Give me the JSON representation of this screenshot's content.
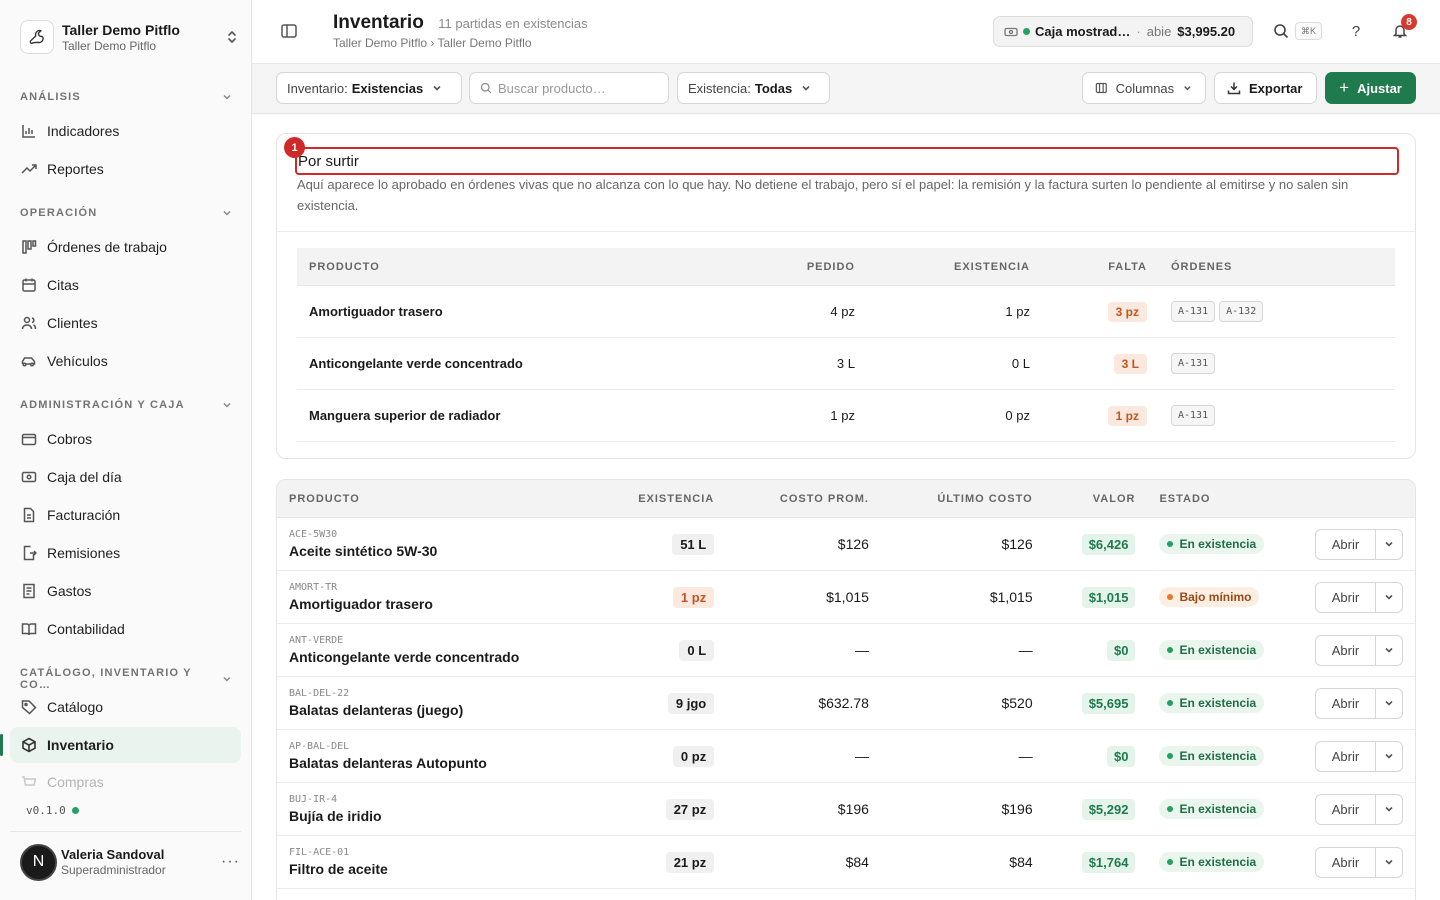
{
  "sidebar": {
    "org_name": "Taller Demo Pitflo",
    "org_sub": "Taller Demo Pitflo",
    "sections": [
      {
        "title": "ANÁLISIS",
        "items": [
          {
            "label": "Indicadores",
            "icon": "bar-chart-icon"
          },
          {
            "label": "Reportes",
            "icon": "trend-up-icon"
          }
        ]
      },
      {
        "title": "OPERACIÓN",
        "items": [
          {
            "label": "Órdenes de trabajo",
            "icon": "kanban-icon"
          },
          {
            "label": "Citas",
            "icon": "calendar-icon"
          },
          {
            "label": "Clientes",
            "icon": "users-icon"
          },
          {
            "label": "Vehículos",
            "icon": "car-icon"
          }
        ]
      },
      {
        "title": "ADMINISTRACIÓN Y CAJA",
        "items": [
          {
            "label": "Cobros",
            "icon": "wallet-icon"
          },
          {
            "label": "Caja del día",
            "icon": "cash-register-icon"
          },
          {
            "label": "Facturación",
            "icon": "invoice-icon"
          },
          {
            "label": "Remisiones",
            "icon": "file-export-icon"
          },
          {
            "label": "Gastos",
            "icon": "receipt-icon"
          },
          {
            "label": "Contabilidad",
            "icon": "book-icon"
          }
        ]
      },
      {
        "title": "CATÁLOGO, INVENTARIO Y CO…",
        "items": [
          {
            "label": "Catálogo",
            "icon": "tag-icon"
          },
          {
            "label": "Inventario",
            "icon": "box-icon"
          },
          {
            "label": "Compras",
            "icon": "cart-icon"
          }
        ]
      }
    ],
    "version": "v0.1.0",
    "user": {
      "initial": "N",
      "name": "Valeria Sandoval",
      "role": "Superadministrador",
      "more": "···"
    }
  },
  "header": {
    "title": "Inventario",
    "count": "11 partidas en existencias",
    "breadcrumb": "Taller Demo Pitflo › Taller Demo Pitflo",
    "cash": {
      "name": "Caja mostrad…",
      "sep": "·",
      "status": "abie",
      "amount": "$3,995.20"
    },
    "kbd": "⌘K",
    "help": "?",
    "notifications": "8"
  },
  "toolbar": {
    "inventory_label": "Inventario:",
    "inventory_value": "Existencias",
    "search_placeholder": "Buscar producto…",
    "stock_label": "Existencia:",
    "stock_value": "Todas",
    "columns": "Columnas",
    "export": "Exportar",
    "adjust": "Ajustar"
  },
  "por_surtir": {
    "marker": "1",
    "title": "Por surtir",
    "description": "Aquí aparece lo aprobado en órdenes vivas que no alcanza con lo que hay. No detiene el trabajo, pero sí el papel: la remisión y la factura surten lo pendiente al emitirse y no salen sin existencia.",
    "columns": [
      "PRODUCTO",
      "PEDIDO",
      "EXISTENCIA",
      "FALTA",
      "ÓRDENES"
    ],
    "rows": [
      {
        "product": "Amortiguador trasero",
        "ordered": "4 pz",
        "stock": "1 pz",
        "missing": "3 pz",
        "orders": [
          "A-131",
          "A-132"
        ]
      },
      {
        "product": "Anticongelante verde concentrado",
        "ordered": "3 L",
        "stock": "0 L",
        "missing": "3 L",
        "orders": [
          "A-131"
        ]
      },
      {
        "product": "Manguera superior de radiador",
        "ordered": "1 pz",
        "stock": "0 pz",
        "missing": "1 pz",
        "orders": [
          "A-131"
        ]
      }
    ]
  },
  "inventory": {
    "columns": [
      "PRODUCTO",
      "EXISTENCIA",
      "COSTO PROM.",
      "ÚLTIMO COSTO",
      "VALOR",
      "ESTADO"
    ],
    "open_label": "Abrir",
    "rows": [
      {
        "sku": "ACE-5W30",
        "name": "Aceite sintético 5W-30",
        "stock": "51 L",
        "low": false,
        "avg": "$126",
        "last": "$126",
        "value": "$6,426",
        "status": "En existencia",
        "warn": false
      },
      {
        "sku": "AMORT-TR",
        "name": "Amortiguador trasero",
        "stock": "1 pz",
        "low": true,
        "avg": "$1,015",
        "last": "$1,015",
        "value": "$1,015",
        "status": "Bajo mínimo",
        "warn": true
      },
      {
        "sku": "ANT-VERDE",
        "name": "Anticongelante verde concentrado",
        "stock": "0 L",
        "low": false,
        "avg": "—",
        "last": "—",
        "value": "$0",
        "status": "En existencia",
        "warn": false
      },
      {
        "sku": "BAL-DEL-22",
        "name": "Balatas delanteras (juego)",
        "stock": "9 jgo",
        "low": false,
        "avg": "$632.78",
        "last": "$520",
        "value": "$5,695",
        "status": "En existencia",
        "warn": false
      },
      {
        "sku": "AP-BAL-DEL",
        "name": "Balatas delanteras Autopunto",
        "stock": "0 pz",
        "low": false,
        "avg": "—",
        "last": "—",
        "value": "$0",
        "status": "En existencia",
        "warn": false
      },
      {
        "sku": "BUJ-IR-4",
        "name": "Bujía de iridio",
        "stock": "27 pz",
        "low": false,
        "avg": "$196",
        "last": "$196",
        "value": "$5,292",
        "status": "En existencia",
        "warn": false
      },
      {
        "sku": "FIL-ACE-01",
        "name": "Filtro de aceite",
        "stock": "21 pz",
        "low": false,
        "avg": "$84",
        "last": "$84",
        "value": "$1,764",
        "status": "En existencia",
        "warn": false
      }
    ]
  }
}
